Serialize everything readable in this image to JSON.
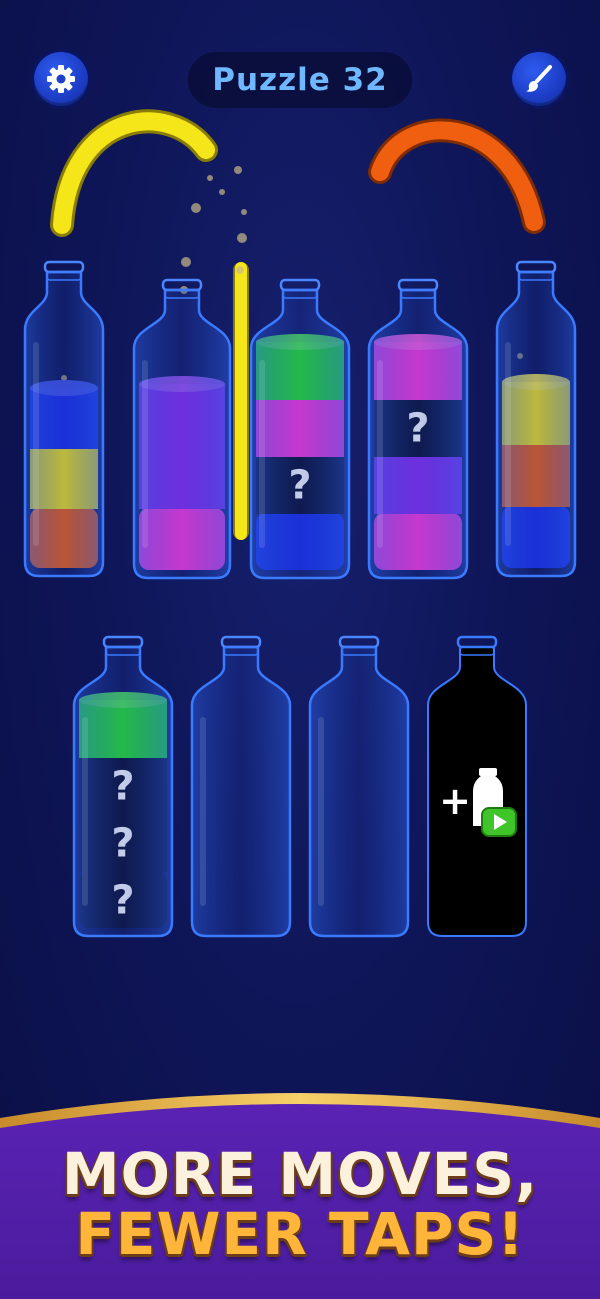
{
  "header": {
    "title": "Puzzle 32",
    "settings_icon": "gear-icon",
    "theme_icon": "paintbrush-icon"
  },
  "colors": {
    "blue": "#1a2ee8",
    "yellow": "#f2e319",
    "orange": "#f05e0f",
    "purple": "#8a2cf0",
    "pink": "#ff38dc",
    "green": "#27e42a",
    "hidden": "#0b0f30"
  },
  "bottles_row1": [
    {
      "layers": [
        "orange",
        "yellow",
        "blue"
      ]
    },
    {
      "layers": [
        "pink",
        "purple",
        "purple"
      ]
    },
    {
      "layers": [
        "blue",
        "hidden",
        "pink",
        "green"
      ]
    },
    {
      "layers": [
        "pink",
        "purple",
        "hidden",
        "pink"
      ]
    },
    {
      "layers": [
        "blue",
        "orange",
        "yellow"
      ]
    }
  ],
  "bottles_row2": [
    {
      "layers": [
        "hidden",
        "hidden",
        "hidden",
        "green"
      ]
    },
    {
      "layers": []
    },
    {
      "layers": []
    },
    {
      "locked": true,
      "icon": "add-bottle-video-icon"
    }
  ],
  "hidden_mark": "?",
  "add_bottle_plus": "+",
  "banner": {
    "line1": "MORE MOVES,",
    "line2": "FEWER TAPS!"
  }
}
